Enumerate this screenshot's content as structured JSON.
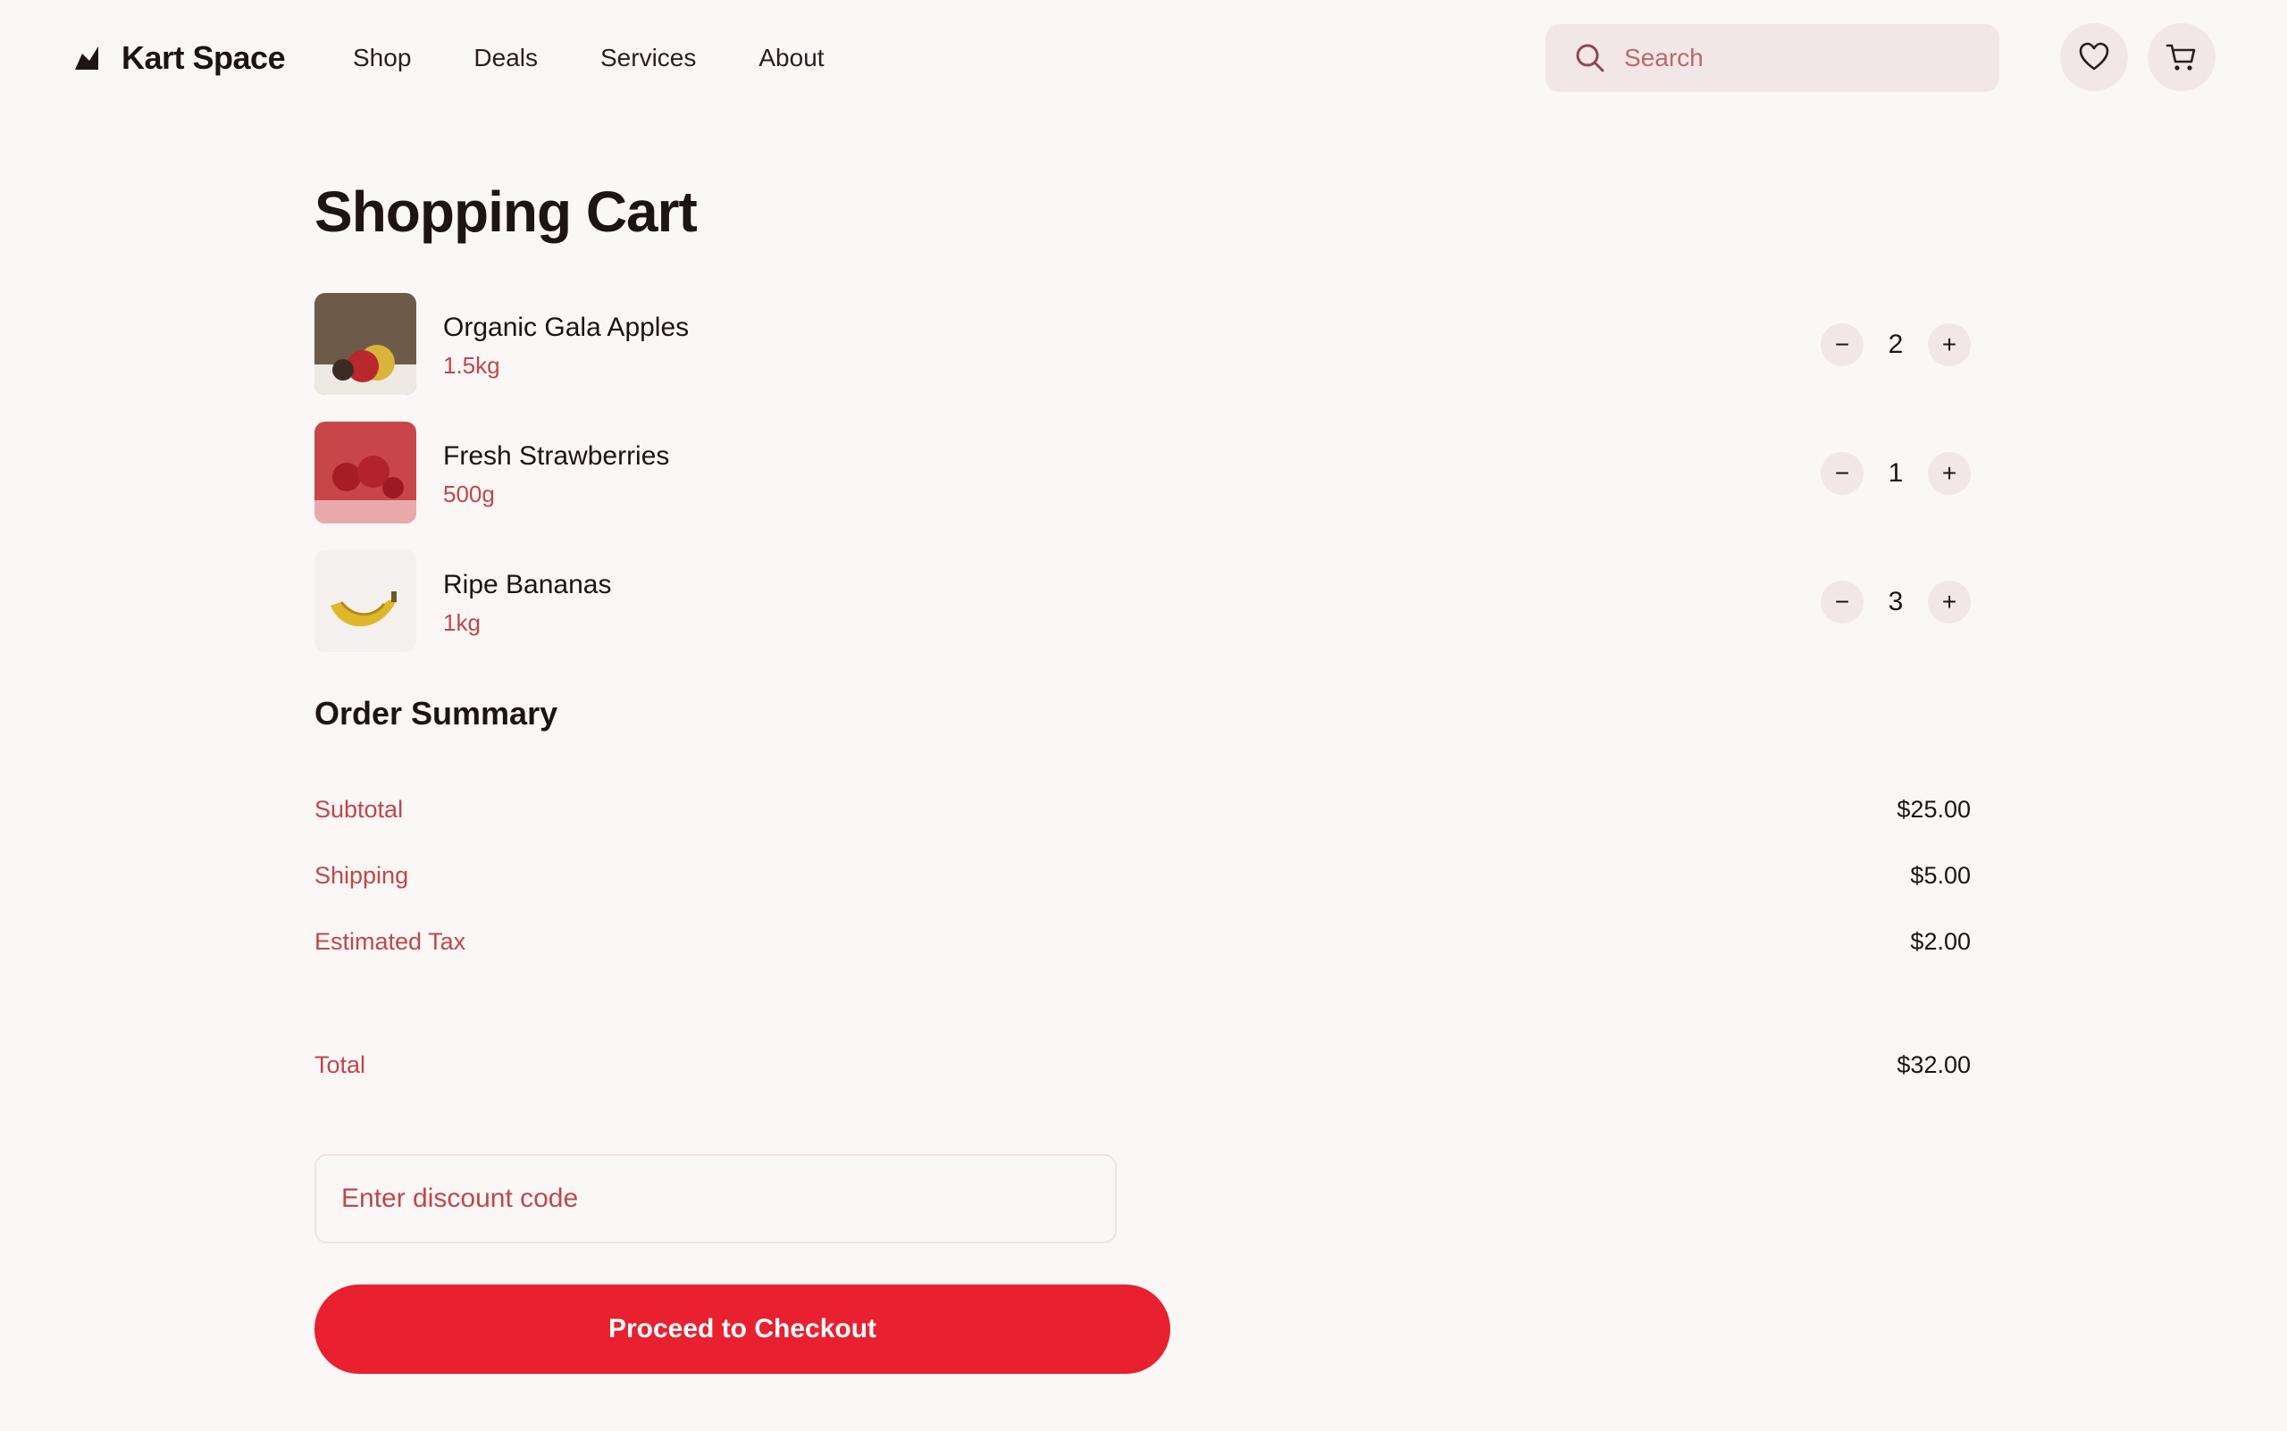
{
  "brand": {
    "name": "Kart Space"
  },
  "nav": [
    "Shop",
    "Deals",
    "Services",
    "About"
  ],
  "search": {
    "placeholder": "Search"
  },
  "page": {
    "title": "Shopping Cart"
  },
  "cart": {
    "items": [
      {
        "name": "Organic Gala Apples",
        "size": "1.5kg",
        "quantity": "2",
        "thumb": "apples-image"
      },
      {
        "name": "Fresh Strawberries",
        "size": "500g",
        "quantity": "1",
        "thumb": "strawberries-image"
      },
      {
        "name": "Ripe Bananas",
        "size": "1kg",
        "quantity": "3",
        "thumb": "bananas-image"
      }
    ],
    "decrease_symbol": "−",
    "increase_symbol": "+"
  },
  "summary": {
    "title": "Order Summary",
    "subtotal_label": "Subtotal",
    "subtotal_value": "$25.00",
    "shipping_label": "Shipping",
    "shipping_value": "$5.00",
    "tax_label": "Estimated Tax",
    "tax_value": "$2.00",
    "total_label": "Total",
    "total_value": "$32.00"
  },
  "discount": {
    "placeholder": "Enter discount code"
  },
  "checkout": {
    "label": "Proceed to Checkout"
  },
  "colors": {
    "background": "#fbf7f6",
    "accent": "#e8202f",
    "muted_text": "#c0474b",
    "chip_bg": "#f2e7e7"
  }
}
